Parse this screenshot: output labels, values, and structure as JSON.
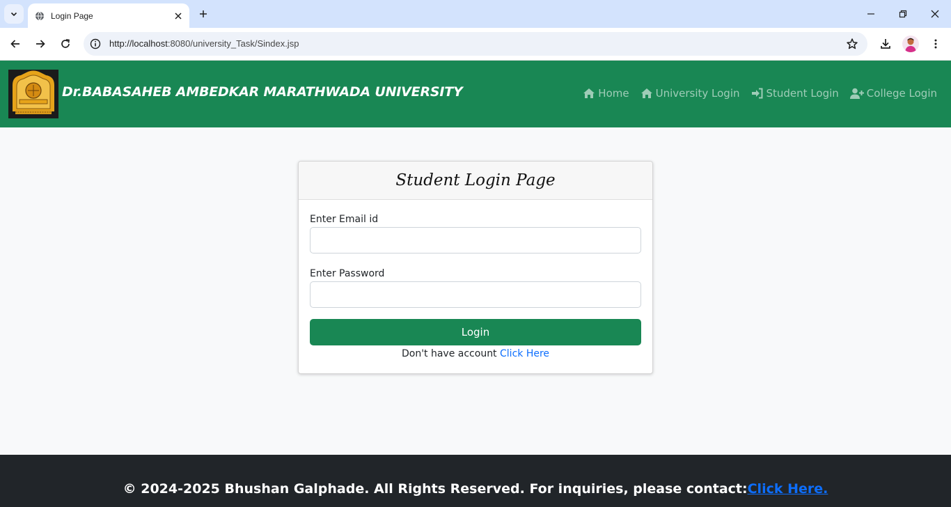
{
  "browser": {
    "tab_title": "Login Page",
    "url_host": "http://localhost",
    "url_rest": ":8080/university_Task/Sindex.jsp"
  },
  "site": {
    "brand": "Dr.BABASAHEB AMBEDKAR MARATHWADA UNIVERSITY",
    "nav": [
      {
        "label": "Home",
        "icon": "house-icon"
      },
      {
        "label": "University Login",
        "icon": "house-icon"
      },
      {
        "label": "Student Login",
        "icon": "sign-in-icon"
      },
      {
        "label": "College Login",
        "icon": "user-plus-icon"
      }
    ]
  },
  "form": {
    "title": "Student Login Page",
    "email_label": "Enter Email id",
    "email_value": "",
    "password_label": "Enter Password",
    "password_value": "",
    "login_label": "Login",
    "signup_prompt": "Don't have account ",
    "signup_link": "Click Here"
  },
  "footer": {
    "text": "© 2024-2025 Bhushan Galphade. All Rights Reserved. For inquiries, please contact:",
    "link": "Click Here."
  },
  "colors": {
    "brand_green": "#198754",
    "link_blue": "#0d6efd",
    "footer_dark": "#212529"
  }
}
